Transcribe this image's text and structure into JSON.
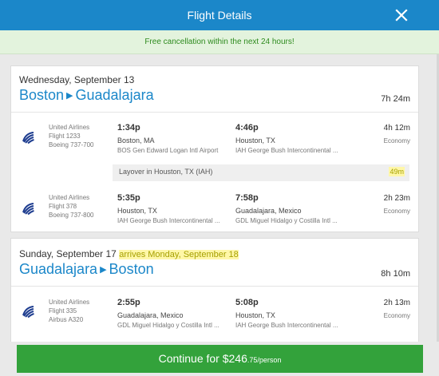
{
  "header": {
    "title": "Flight Details"
  },
  "promo": {
    "text": "Free cancellation within the next 24 hours!"
  },
  "trips": [
    {
      "date": "Wednesday, September 13",
      "origin": "Boston",
      "destination": "Guadalajara",
      "total_duration": "7h 24m",
      "segments": [
        {
          "airline": "United Airlines",
          "flight": "Flight 1233",
          "aircraft": "Boeing 737-700",
          "depart_time": "1:34p",
          "depart_city": "Boston, MA",
          "depart_airport": "BOS Gen Edward Logan Intl Airport",
          "arrive_time": "4:46p",
          "arrive_city": "Houston, TX",
          "arrive_airport": "IAH George Bush Intercontinental ...",
          "duration": "4h 12m",
          "cabin": "Economy"
        },
        {
          "airline": "United Airlines",
          "flight": "Flight 378",
          "aircraft": "Boeing 737-800",
          "depart_time": "5:35p",
          "depart_city": "Houston, TX",
          "depart_airport": "IAH George Bush Intercontinental ...",
          "arrive_time": "7:58p",
          "arrive_city": "Guadalajara, Mexico",
          "arrive_airport": "GDL Miguel Hidalgo y Costilla Intl ...",
          "duration": "2h 23m",
          "cabin": "Economy"
        }
      ],
      "layover": {
        "text": "Layover in Houston, TX (IAH)",
        "duration": "49m"
      }
    },
    {
      "date": "Sunday, September 17",
      "arrival_note": "arrives Monday, September 18",
      "origin": "Guadalajara",
      "destination": "Boston",
      "total_duration": "8h 10m",
      "segments": [
        {
          "airline": "United Airlines",
          "flight": "Flight 335",
          "aircraft": "Airbus A320",
          "depart_time": "2:55p",
          "depart_city": "Guadalajara, Mexico",
          "depart_airport": "GDL Miguel Hidalgo y Costilla Intl ...",
          "arrive_time": "5:08p",
          "arrive_city": "Houston, TX",
          "arrive_airport": "IAH George Bush Intercontinental ...",
          "duration": "2h 13m",
          "cabin": "Economy"
        }
      ]
    }
  ],
  "cta": {
    "label": "Continue for $246",
    "cents": ".75/person"
  },
  "colors": {
    "header": "#1b87c9",
    "accent_green": "#33a23b",
    "promo_bg": "#e3f3dd",
    "highlight": "#fff7a8"
  },
  "icons": {
    "close": "close-icon",
    "airline_logo": "united-airlines-logo-icon",
    "route_arrow": "triangle-right-icon"
  }
}
